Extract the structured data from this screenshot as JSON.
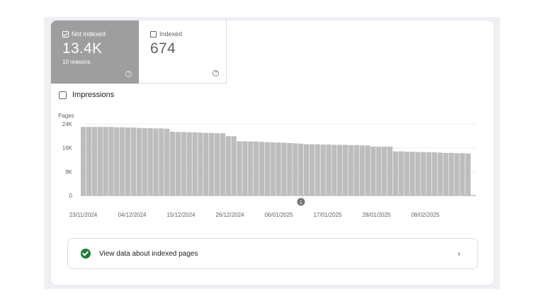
{
  "tiles": {
    "not_indexed": {
      "label": "Not indexed",
      "value": "13.4K",
      "sub": "10 reasons",
      "checked": true
    },
    "indexed": {
      "label": "Indexed",
      "value": "674",
      "checked": false
    }
  },
  "impressions_label": "Impressions",
  "help_glyph": "?",
  "annotation_marker": "1",
  "cta": {
    "label": "View data about indexed pages",
    "chevron": "›"
  },
  "colors": {
    "bar": "#bdbdbd",
    "selected_tile": "#9e9e9e",
    "success": "#188038"
  },
  "chart_data": {
    "type": "bar",
    "ylabel": "Pages",
    "yticks": [
      "24K",
      "16K",
      "8K",
      "0"
    ],
    "ylim": [
      0,
      24000
    ],
    "x_labels": [
      "23/11/2024",
      "04/12/2024",
      "15/12/2024",
      "26/12/2024",
      "06/01/2025",
      "17/01/2025",
      "28/01/2025",
      "08/02/2025"
    ],
    "values": [
      23000,
      23000,
      23000,
      23000,
      23000,
      23000,
      22900,
      22900,
      22800,
      22800,
      22700,
      22600,
      22600,
      22500,
      22500,
      22400,
      21400,
      21300,
      21300,
      21200,
      21200,
      21100,
      21000,
      21000,
      20900,
      20900,
      19900,
      19900,
      18200,
      18200,
      18100,
      18100,
      18000,
      17900,
      17800,
      17800,
      17700,
      17600,
      17500,
      17400,
      17200,
      17200,
      17200,
      17100,
      17100,
      17000,
      17000,
      17000,
      16900,
      16900,
      16800,
      16800,
      16400,
      16400,
      16400,
      16400,
      14800,
      14800,
      14700,
      14700,
      14600,
      14600,
      14500,
      14500,
      14400,
      14300,
      14300,
      14200,
      14200,
      14100
    ],
    "annotation_index": 39,
    "grid": true
  }
}
